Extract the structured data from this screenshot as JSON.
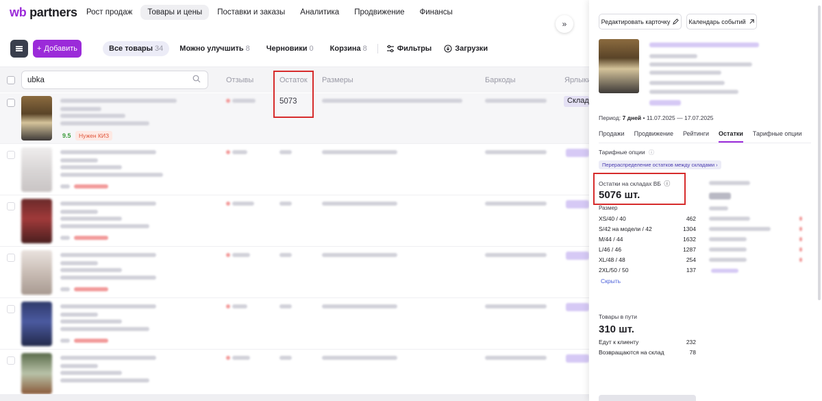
{
  "logo": {
    "brand_wb": "wb",
    "brand_rest": " partners"
  },
  "nav": {
    "items": [
      {
        "label": "Рост продаж",
        "active": false
      },
      {
        "label": "Товары и цены",
        "active": true
      },
      {
        "label": "Поставки и заказы",
        "active": false
      },
      {
        "label": "Аналитика",
        "active": false
      },
      {
        "label": "Продвижение",
        "active": false
      },
      {
        "label": "Финансы",
        "active": false
      }
    ]
  },
  "toolbar": {
    "add_label": "Добавить",
    "tabs": [
      {
        "label": "Все товары",
        "count": "34",
        "active": true
      },
      {
        "label": "Можно улучшить",
        "count": "8",
        "active": false
      },
      {
        "label": "Черновики",
        "count": "0",
        "active": false
      },
      {
        "label": "Корзина",
        "count": "8",
        "active": false
      }
    ],
    "filters_label": "Фильтры",
    "downloads_label": "Загрузки"
  },
  "table": {
    "search_value": "ubka",
    "columns": {
      "reviews": "Отзывы",
      "stock": "Остаток",
      "sizes": "Размеры",
      "barcodes": "Баркоды",
      "labels": "Ярлыки"
    },
    "first_row": {
      "stock": "5073",
      "rating": "9.5",
      "kiz_badge": "Нужен КИЗ",
      "label_chip": "Склад"
    }
  },
  "panel": {
    "edit_card_label": "Редактировать карточку",
    "calendar_label": "Календарь событий",
    "period_prefix": "Период:",
    "period_value": "7 дней",
    "period_range": "• 11.07.2025 — 17.07.2025",
    "tabs": [
      {
        "label": "Продажи",
        "active": false
      },
      {
        "label": "Продвижение",
        "active": false
      },
      {
        "label": "Рейтинги",
        "active": false
      },
      {
        "label": "Остатки",
        "active": true
      },
      {
        "label": "Тарифные опции",
        "active": false
      }
    ],
    "tariff_label": "Тарифные опции",
    "tariff_chip": "Перераспределение остатков между складами",
    "stock_label": "Остатки на складах ВБ",
    "stock_total": "5076 шт.",
    "size_header": "Размер",
    "sizes": [
      {
        "size": "XS/40 / 40",
        "qty": "462"
      },
      {
        "size": "S/42 на модели / 42",
        "qty": "1304"
      },
      {
        "size": "M/44 / 44",
        "qty": "1632"
      },
      {
        "size": "L/46 / 46",
        "qty": "1287"
      },
      {
        "size": "XL/48 / 48",
        "qty": "254"
      },
      {
        "size": "2XL/50 / 50",
        "qty": "137"
      }
    ],
    "hide_label": "Скрыть",
    "transit_label": "Товары в пути",
    "transit_total": "310 шт.",
    "transit_rows": [
      {
        "label": "Едут к клиенту",
        "qty": "232"
      },
      {
        "label": "Возвращаются на склад",
        "qty": "78"
      }
    ]
  },
  "colors": {
    "brand_purple": "#9b2bd9",
    "highlight_red": "#d62b2b",
    "link_blue": "#4a5fd9"
  }
}
